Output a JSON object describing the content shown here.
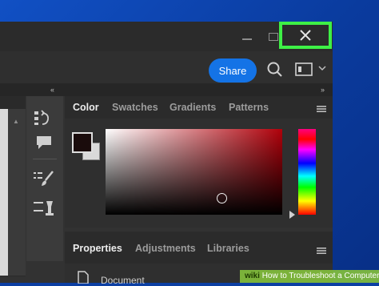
{
  "toolbar": {
    "share_label": "Share"
  },
  "color_panel": {
    "tabs": [
      {
        "label": "Color"
      },
      {
        "label": "Swatches"
      },
      {
        "label": "Gradients"
      },
      {
        "label": "Patterns"
      }
    ],
    "foreground_color": "#1a0c0c",
    "background_color": "#d9d9d9",
    "picker_hue_color": "#b0000a"
  },
  "properties_panel": {
    "tabs": [
      {
        "label": "Properties"
      },
      {
        "label": "Adjustments"
      },
      {
        "label": "Libraries"
      }
    ],
    "item_label": "Document"
  },
  "highlight_color": "#3ef046",
  "watermark": {
    "brand": "wiki",
    "text": "How to Troubleshoot a Computer"
  }
}
